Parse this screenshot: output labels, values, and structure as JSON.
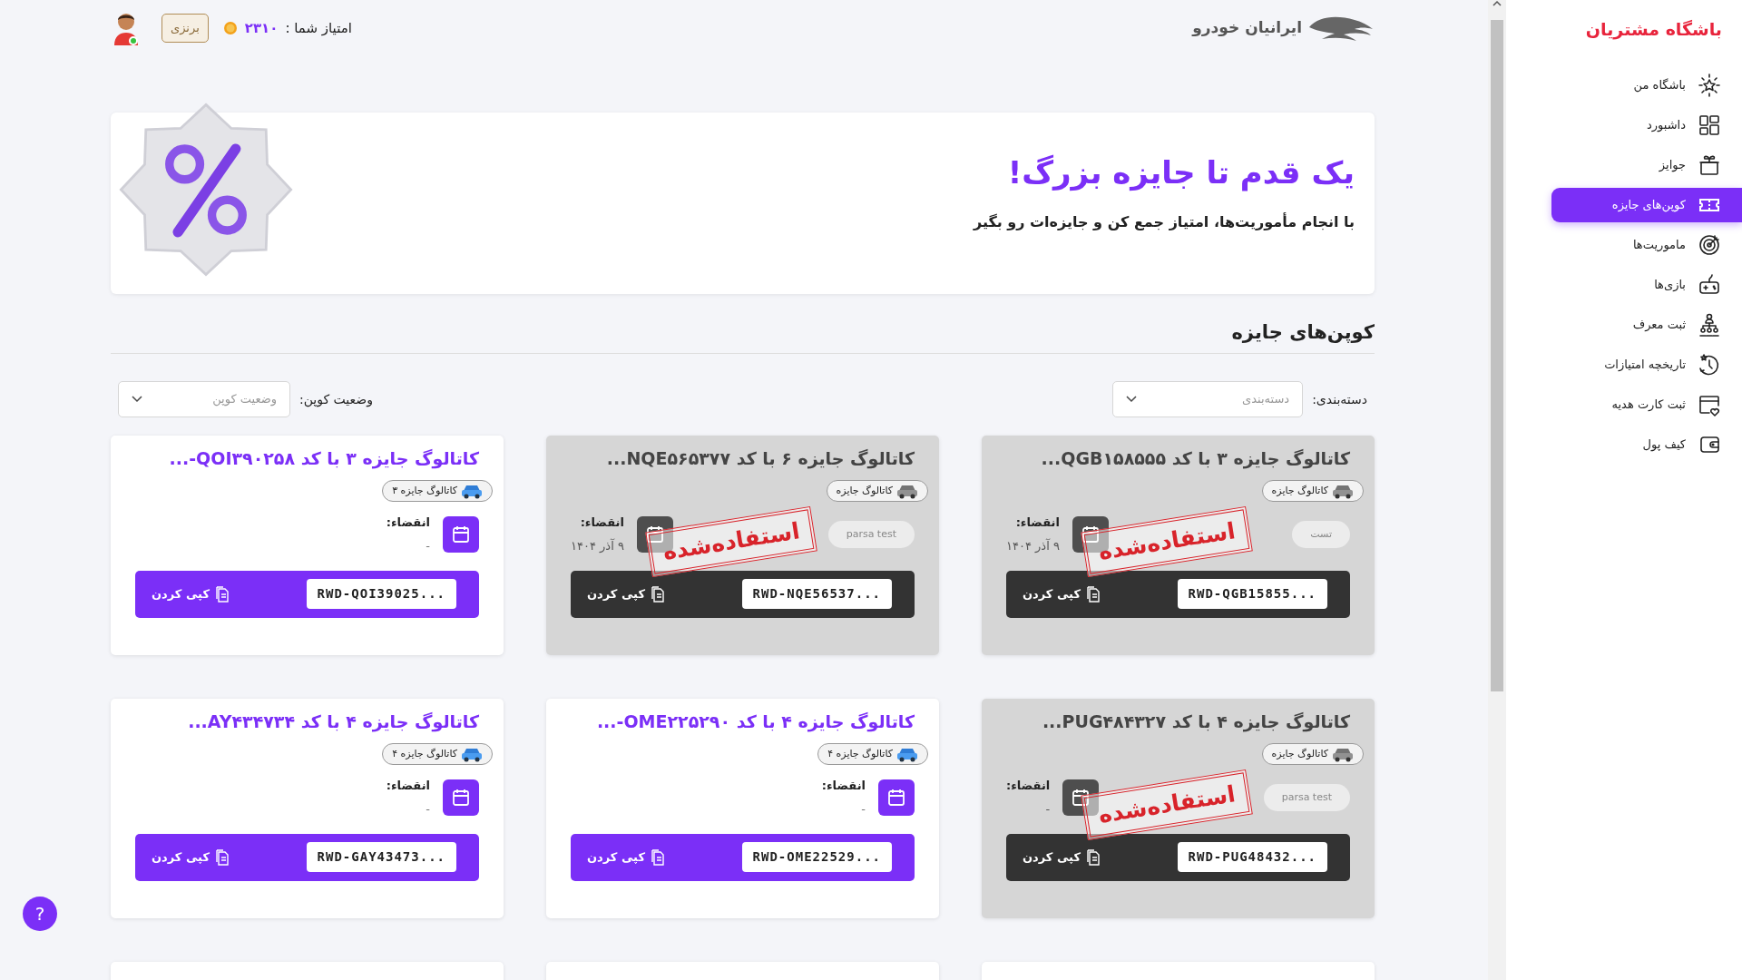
{
  "sidebar": {
    "title": "باشگاه مشتریان",
    "items": [
      {
        "label": "باشگاه من",
        "selected": false
      },
      {
        "label": "داشبورد",
        "selected": false
      },
      {
        "label": "جوایز",
        "selected": false
      },
      {
        "label": "کوپن‌های جایزه",
        "selected": true
      },
      {
        "label": "ماموریت‌ها",
        "selected": false
      },
      {
        "label": "بازی‌ها",
        "selected": false
      },
      {
        "label": "ثبت معرف",
        "selected": false
      },
      {
        "label": "تاریخچه امتیازات",
        "selected": false
      },
      {
        "label": "ثبت کارت هدیه",
        "selected": false
      },
      {
        "label": "کیف پول",
        "selected": false
      }
    ]
  },
  "header": {
    "logo_text": "ایرانیان خودرو",
    "score_label": "امتیاز شما :",
    "score": "۲۳۱۰",
    "level_badge": "برنزی",
    "online": true
  },
  "banner": {
    "title": "یک قدم تا جایزه بزرگ!",
    "subtitle": "با انجام مأموریت‌ها، امتیاز جمع کن و جایزه‌ات رو بگیر"
  },
  "section_title": "کوپن‌های جایزه",
  "filters": [
    {
      "label": "دسته‌بندی:",
      "placeholder": "دسته‌بندی"
    },
    {
      "label": "وضعیت کوپن:",
      "placeholder": "وضعیت کوپن"
    }
  ],
  "coupons": [
    {
      "kind": "used",
      "title": "کاتالوگ جایزه ۳ با کد QGB۱۵۸۵۵۵...",
      "chip": "کاتالوگ جایزه",
      "tag": "تست",
      "expiry_label": "انقضاء:",
      "expiry": "۹ آذر ۱۴۰۴",
      "code": "RWD-QGB15855...",
      "copy": "کپی کردن",
      "stamp": "استفاده‌شده"
    },
    {
      "kind": "used",
      "title": "کاتالوگ جایزه ۶ با کد NQE۵۶۵۳۷۷...",
      "chip": "کاتالوگ جایزه",
      "tag": "parsa test",
      "expiry_label": "انقضاء:",
      "expiry": "۹ آذر ۱۴۰۴",
      "code": "RWD-NQE56537...",
      "copy": "کپی کردن",
      "stamp": "استفاده‌شده"
    },
    {
      "kind": "available",
      "title": "کاتالوگ جایزه ۳ با کد QOI۳۹۰۲۵۸-...",
      "chip": "کاتالوگ جایزه ۳",
      "expiry_label": "انقضاء:",
      "expiry": "-",
      "code": "RWD-QOI39025...",
      "copy": "کپی کردن"
    },
    {
      "kind": "used",
      "title": "کاتالوگ جایزه ۴ با کد PUG۴۸۴۳۲۷...",
      "chip": "کاتالوگ جایزه",
      "tag": "parsa test",
      "expiry_label": "انقضاء:",
      "expiry": "-",
      "code": "RWD-PUG48432...",
      "copy": "کپی کردن",
      "stamp": "استفاده‌شده"
    },
    {
      "kind": "available",
      "title": "کاتالوگ جایزه ۴ با کد OME۲۲۵۲۹۰-...",
      "chip": "کاتالوگ جایزه ۴",
      "expiry_label": "انقضاء:",
      "expiry": "-",
      "code": "RWD-OME22529...",
      "copy": "کپی کردن"
    },
    {
      "kind": "available",
      "title": "کاتالوگ جایزه ۴ با کد AY۴۳۴۷۳۴...",
      "chip": "کاتالوگ جایزه ۴",
      "expiry_label": "انقضاء:",
      "expiry": "-",
      "code": "RWD-GAY43473...",
      "copy": "کپی کردن"
    },
    {
      "kind": "cut_off"
    },
    {
      "kind": "cut_off"
    },
    {
      "kind": "cut_off"
    }
  ],
  "help": "?"
}
